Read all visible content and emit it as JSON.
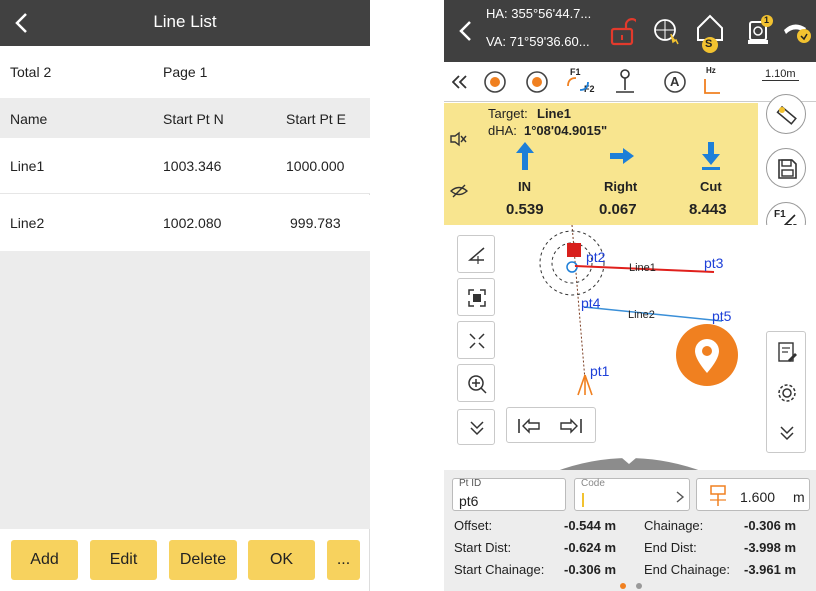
{
  "line_list": {
    "title": "Line List",
    "total": "Total 2",
    "page": "Page 1",
    "columns": [
      "Name",
      "Start Pt N",
      "Start Pt E"
    ],
    "rows": [
      {
        "name": "Line1",
        "n": "1003.346",
        "e": "1000.000"
      },
      {
        "name": "Line2",
        "n": "1002.080",
        "e": "999.783"
      }
    ],
    "buttons": {
      "add": "Add",
      "edit": "Edit",
      "delete": "Delete",
      "ok": "OK",
      "more": "..."
    }
  },
  "stakeout": {
    "ha": "HA: 355°56'44.7...",
    "va": "VA: 71°59'36.60...",
    "badge_count": "1",
    "s_label": "S",
    "tool_f12": "F1",
    "tool_f12b": "F2",
    "tool_a": "A",
    "tool_hz": "Hz",
    "height": "1.10m",
    "target_label": "Target:",
    "target_value": "Line1",
    "dha_label": "dHA:",
    "dha_value": "1°08'04.9015\"",
    "dirs": [
      {
        "label": "IN",
        "value": "0.539"
      },
      {
        "label": "Right",
        "value": "0.067"
      },
      {
        "label": "Cut",
        "value": "8.443"
      }
    ],
    "f12_btn_a": "F1",
    "f12_btn_b": "F2",
    "map": {
      "pt1": "pt1",
      "pt2": "pt2",
      "pt3": "pt3",
      "pt4": "pt4",
      "pt5": "pt5",
      "line1": "Line1",
      "line2": "Line2"
    },
    "ptid_label": "Pt ID",
    "ptid_value": "pt6",
    "code_label": "Code",
    "rod_value": "1.600",
    "rod_unit": "m",
    "info": {
      "offset_label": "Offset:",
      "offset_value": "-0.544 m",
      "chainage_label": "Chainage:",
      "chainage_value": "-0.306 m",
      "start_dist_label": "Start Dist:",
      "start_dist_value": "-0.624 m",
      "end_dist_label": "End Dist:",
      "end_dist_value": "-3.998 m",
      "start_ch_label": "Start Chainage:",
      "start_ch_value": "-0.306 m",
      "end_ch_label": "End Chainage:",
      "end_ch_value": "-3.961 m"
    },
    "colors": {
      "accent": "#f08020",
      "yellow": "#f8e58f",
      "blue": "#1e7fd8",
      "red": "#e0201c"
    }
  }
}
